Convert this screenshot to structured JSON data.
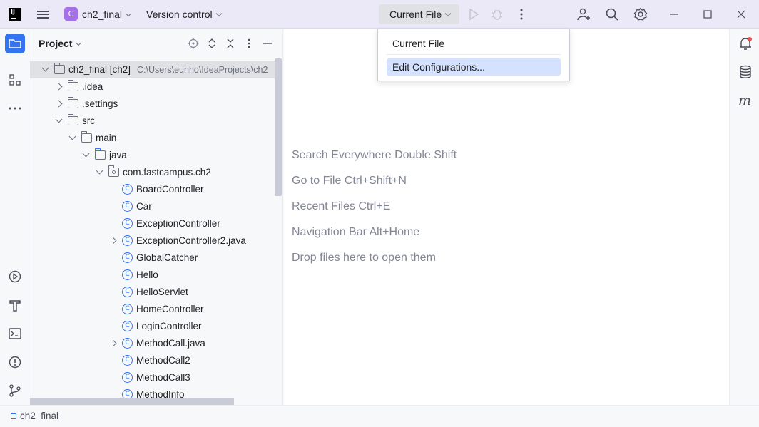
{
  "titlebar": {
    "logo_text": "IJ",
    "project_badge": "C",
    "project_name": "ch2_final",
    "vcs_label": "Version control",
    "run_config": "Current File"
  },
  "project_panel": {
    "title": "Project",
    "tree": [
      {
        "label": "ch2_final [ch2]",
        "hint": "C:\\Users\\eunho\\IdeaProjects\\ch2",
        "kind": "module",
        "depth": 0,
        "expand": "open",
        "selected": true
      },
      {
        "label": ".idea",
        "kind": "folder",
        "depth": 1,
        "expand": "closed"
      },
      {
        "label": ".settings",
        "kind": "folder",
        "depth": 1,
        "expand": "closed"
      },
      {
        "label": "src",
        "kind": "folder",
        "depth": 1,
        "expand": "open"
      },
      {
        "label": "main",
        "kind": "folder",
        "depth": 2,
        "expand": "open"
      },
      {
        "label": "java",
        "kind": "folder-blue",
        "depth": 3,
        "expand": "open"
      },
      {
        "label": "com.fastcampus.ch2",
        "kind": "package",
        "depth": 4,
        "expand": "open"
      },
      {
        "label": "BoardController",
        "kind": "class",
        "depth": 5,
        "expand": "none"
      },
      {
        "label": "Car",
        "kind": "class",
        "depth": 5,
        "expand": "none"
      },
      {
        "label": "ExceptionController",
        "kind": "class",
        "depth": 5,
        "expand": "none"
      },
      {
        "label": "ExceptionController2.java",
        "kind": "class",
        "depth": 5,
        "expand": "closed"
      },
      {
        "label": "GlobalCatcher",
        "kind": "class",
        "depth": 5,
        "expand": "none"
      },
      {
        "label": "Hello",
        "kind": "class",
        "depth": 5,
        "expand": "none"
      },
      {
        "label": "HelloServlet",
        "kind": "class",
        "depth": 5,
        "expand": "none"
      },
      {
        "label": "HomeController",
        "kind": "class",
        "depth": 5,
        "expand": "none"
      },
      {
        "label": "LoginController",
        "kind": "class",
        "depth": 5,
        "expand": "none"
      },
      {
        "label": "MethodCall.java",
        "kind": "class",
        "depth": 5,
        "expand": "closed"
      },
      {
        "label": "MethodCall2",
        "kind": "class",
        "depth": 5,
        "expand": "none"
      },
      {
        "label": "MethodCall3",
        "kind": "class",
        "depth": 5,
        "expand": "none"
      },
      {
        "label": "MethodInfo",
        "kind": "class",
        "depth": 5,
        "expand": "none"
      }
    ]
  },
  "editor": {
    "hints": [
      "Search Everywhere Double Shift",
      "Go to File Ctrl+Shift+N",
      "Recent Files Ctrl+E",
      "Navigation Bar Alt+Home",
      "Drop files here to open them"
    ]
  },
  "popup": {
    "items": [
      {
        "label": "Current File",
        "highlighted": false
      },
      {
        "label": "Edit Configurations...",
        "highlighted": true
      }
    ]
  },
  "statusbar": {
    "breadcrumb": "ch2_final"
  },
  "colors": {
    "accent": "#3574f0",
    "titlebar_bg": "#ebe9f7",
    "project_badge": "#a571e6",
    "popup_highlight": "#d4e2ff",
    "notification_dot": "#e55353"
  },
  "icons": {
    "left_strip": [
      "folder-icon",
      "structure-icon",
      "more-icon",
      "run-services-icon",
      "build-icon",
      "terminal-icon",
      "problems-icon",
      "git-icon"
    ],
    "right_strip": [
      "notifications-icon",
      "database-icon",
      "maven-icon"
    ]
  }
}
